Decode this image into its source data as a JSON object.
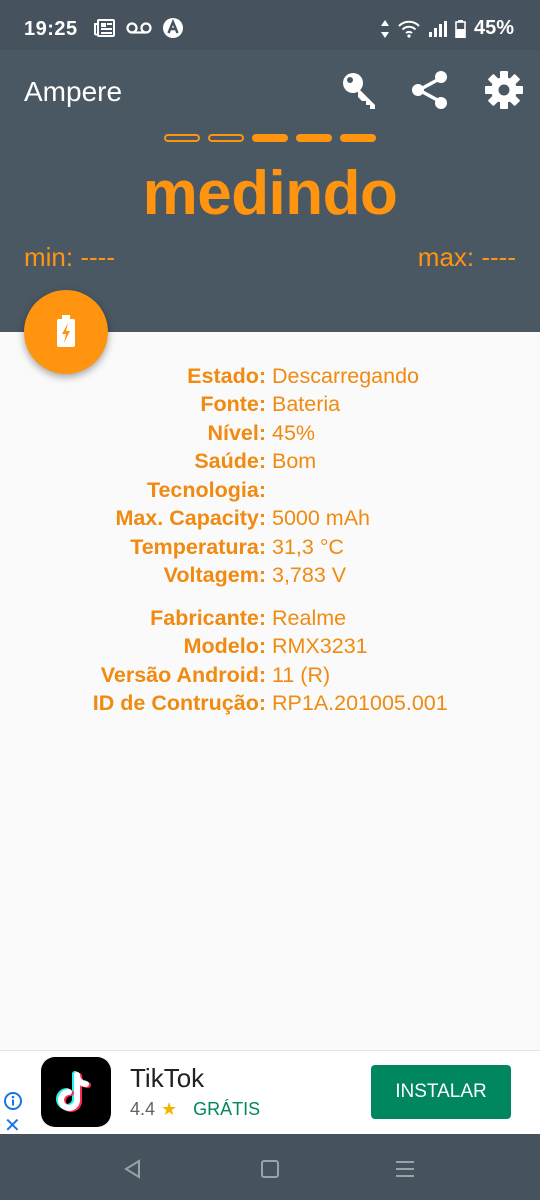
{
  "status_bar": {
    "time": "19:25",
    "battery_percent": "45%",
    "icons_left": [
      "news-icon",
      "voicemail-icon",
      "a-badge-icon"
    ],
    "icons_right": [
      "data-arrows-icon",
      "wifi-icon",
      "signal-icon",
      "battery-icon"
    ]
  },
  "header": {
    "title": "Ampere",
    "actions": [
      "key-icon",
      "share-icon",
      "settings-icon"
    ],
    "indicator": {
      "total": 5,
      "filled": 3
    },
    "status_word": "medindo",
    "min_label": "min: ----",
    "max_label": "max: ----"
  },
  "info": {
    "battery": [
      {
        "label": "Estado:",
        "value": "Descarregando"
      },
      {
        "label": "Fonte:",
        "value": "Bateria"
      },
      {
        "label": "Nível:",
        "value": "45%"
      },
      {
        "label": "Saúde:",
        "value": "Bom"
      },
      {
        "label": "Tecnologia:",
        "value": ""
      },
      {
        "label": "Max. Capacity:",
        "value": "5000 mAh"
      },
      {
        "label": "Temperatura:",
        "value": "31,3 °C"
      },
      {
        "label": "Voltagem:",
        "value": "3,783 V"
      }
    ],
    "device": [
      {
        "label": "Fabricante:",
        "value": "Realme"
      },
      {
        "label": "Modelo:",
        "value": "RMX3231"
      },
      {
        "label": "Versão Android:",
        "value": "11 (R)"
      },
      {
        "label": "ID de Contrução:",
        "value": "RP1A.201005.001"
      }
    ]
  },
  "ad": {
    "app_name": "TikTok",
    "rating": "4.4",
    "price": "GRÁTIS",
    "button": "INSTALAR"
  },
  "colors": {
    "accent": "#ff9410",
    "header_bg": "#4a5863",
    "ad_green": "#01875f"
  }
}
